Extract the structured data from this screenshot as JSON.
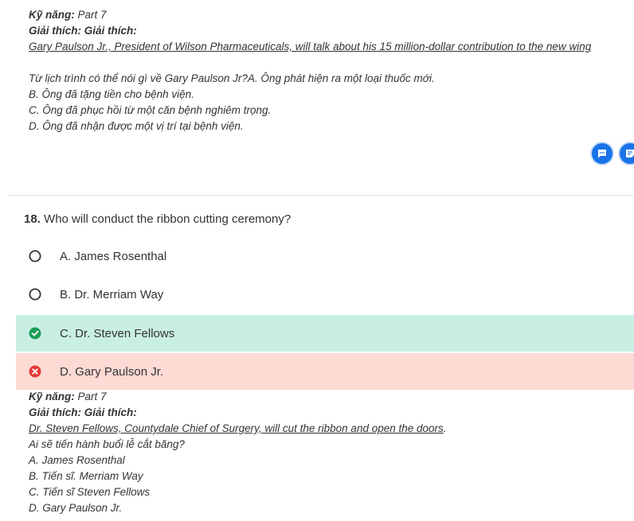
{
  "prev_explanation": {
    "skill_label": "Kỹ năng:",
    "skill_value": "Part 7",
    "explain_label": "Giải thích: Giải thích:",
    "quote": "Gary Paulson Jr., President of Wilson Pharmaceuticals, will talk about his 15 million-dollar contribution to the new wing",
    "lines": [
      "Từ lịch trình có thể nói gì về Gary Paulson Jr?A. Ông phát hiện ra một loại thuốc mới.",
      "B. Ông đã tặng tiền cho bệnh viện.",
      "C. Ông đã phục hồi từ một căn bệnh nghiêm trọng.",
      "D. Ông đã nhận được một vị trí tại bệnh viện."
    ]
  },
  "actions": {
    "comment_icon": "comment-icon",
    "note_icon": "note-icon",
    "accent_color": "#1a73e8"
  },
  "question": {
    "number": "18.",
    "text": "Who will conduct the ribbon cutting ceremony?",
    "options": [
      {
        "label": "A. James Rosenthal",
        "state": "unselected"
      },
      {
        "label": "B. Dr. Merriam Way",
        "state": "unselected"
      },
      {
        "label": "C. Dr. Steven Fellows",
        "state": "correct"
      },
      {
        "label": "D. Gary Paulson Jr.",
        "state": "wrong"
      }
    ],
    "colors": {
      "correct_bg": "#c9efe3",
      "correct_icon": "#1e9e5a",
      "wrong_bg": "#fddad4",
      "wrong_icon": "#e53935"
    }
  },
  "explanation": {
    "skill_label": "Kỹ năng:",
    "skill_value": "Part 7",
    "explain_label": "Giải thích: Giải thích:",
    "quote": "Dr. Steven Fellows, Countydale Chief of Surgery, will cut the ribbon and open the doors",
    "quote_end": ".",
    "lines": [
      "Ai sẽ tiến hành buổi lễ cắt băng?",
      "A. James Rosenthal",
      "B. Tiến sĩ. Merriam Way",
      "C. Tiến sĩ Steven Fellows",
      "D. Gary Paulson Jr."
    ]
  }
}
